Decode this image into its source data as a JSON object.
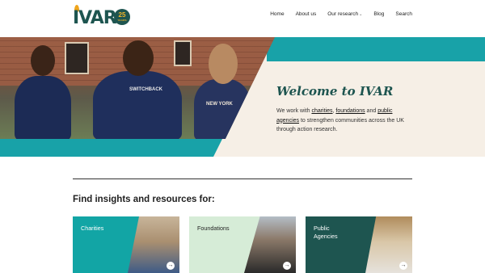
{
  "header": {
    "logo_text": "IVAR",
    "logo_badge_number": "25",
    "logo_badge_caption": "YEARS"
  },
  "nav": {
    "items": [
      {
        "label": "Home"
      },
      {
        "label": "About us"
      },
      {
        "label": "Our research",
        "has_dropdown": true
      },
      {
        "label": "Blog"
      },
      {
        "label": "Search"
      }
    ]
  },
  "hero": {
    "title": "Welcome to IVAR",
    "text_before": "We work with ",
    "link_charities": "charities",
    "sep1": ", ",
    "link_foundations": "foundations",
    "sep2": " and ",
    "link_public_agencies": "public agencies",
    "text_after": " to strengthen communities across the UK through action research.",
    "photo_text_1": "SWITCHBACK",
    "photo_text_2": "NEW YORK"
  },
  "section": {
    "title": "Find insights and resources for:"
  },
  "cards": [
    {
      "label": "Charities"
    },
    {
      "label": "Foundations"
    },
    {
      "label": "Public Agencies"
    }
  ],
  "colors": {
    "teal": "#18a2a8",
    "dark_green": "#1e5550",
    "cream": "#f6efe6",
    "mint": "#d6ecd7",
    "gold": "#f0a51c"
  },
  "icons": [
    "arrow-right-icon",
    "chevron-down-icon"
  ]
}
